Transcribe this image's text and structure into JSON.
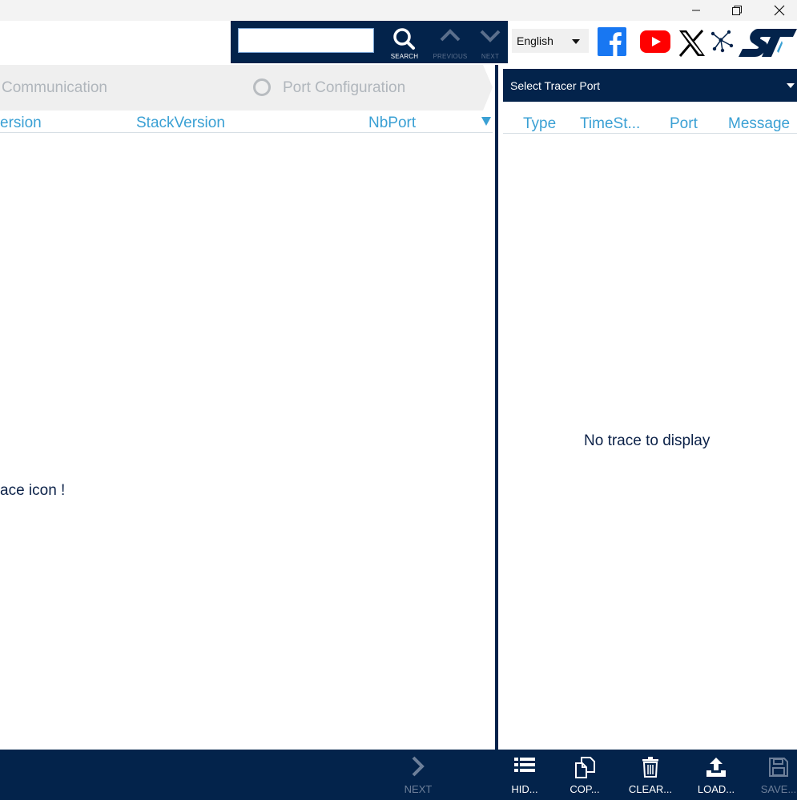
{
  "window": {
    "controls": [
      "minimize",
      "restore",
      "close"
    ]
  },
  "search": {
    "value": "",
    "search_label": "SEARCH",
    "previous_label": "PREVIOUS",
    "next_label": "NEXT"
  },
  "language": {
    "selected": "English"
  },
  "social_icons": [
    "facebook-icon",
    "youtube-icon",
    "x-icon",
    "st-community-icon",
    "st-logo"
  ],
  "steps": [
    {
      "label": "Communication"
    },
    {
      "label": "Port Configuration"
    }
  ],
  "table": {
    "columns": [
      "ersion",
      "StackVersion",
      "NbPort"
    ]
  },
  "main": {
    "hint": "ace icon !"
  },
  "left_footer": {
    "next_label": "NEXT"
  },
  "tracer": {
    "select_label": "Select Tracer Port",
    "columns": [
      "Type",
      "TimeSt...",
      "Port",
      "Message"
    ],
    "empty_message": "No trace to display",
    "buttons": [
      {
        "label": "HID...",
        "icon": "list-icon"
      },
      {
        "label": "COP...",
        "icon": "copy-icon"
      },
      {
        "label": "CLEAR...",
        "icon": "trash-icon"
      },
      {
        "label": "LOAD...",
        "icon": "upload-icon"
      },
      {
        "label": "SAVE...",
        "icon": "save-icon"
      }
    ]
  },
  "colors": {
    "navy": "#03234b",
    "accent_blue": "#3aa0d4",
    "muted": "#b0b6bc"
  }
}
